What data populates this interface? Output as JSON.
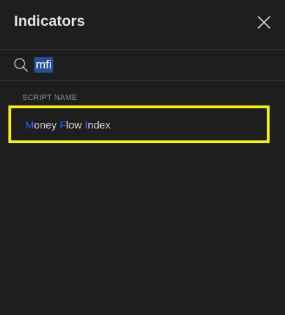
{
  "dialog": {
    "title": "Indicators"
  },
  "search": {
    "value": "mfi",
    "placeholder": ""
  },
  "results": {
    "section_label": "SCRIPT NAME",
    "items": [
      {
        "parts": [
          {
            "text": "M",
            "match": true
          },
          {
            "text": "oney ",
            "match": false
          },
          {
            "text": "F",
            "match": true
          },
          {
            "text": "low ",
            "match": false
          },
          {
            "text": "I",
            "match": true
          },
          {
            "text": "ndex",
            "match": false
          }
        ]
      }
    ]
  },
  "colors": {
    "background": "#1e1e1e",
    "match_highlight": "#2962ff",
    "selection_bg": "#264f9a",
    "focus_outline": "#f7f300"
  },
  "icons": {
    "close": "close-icon",
    "search": "search-icon"
  }
}
